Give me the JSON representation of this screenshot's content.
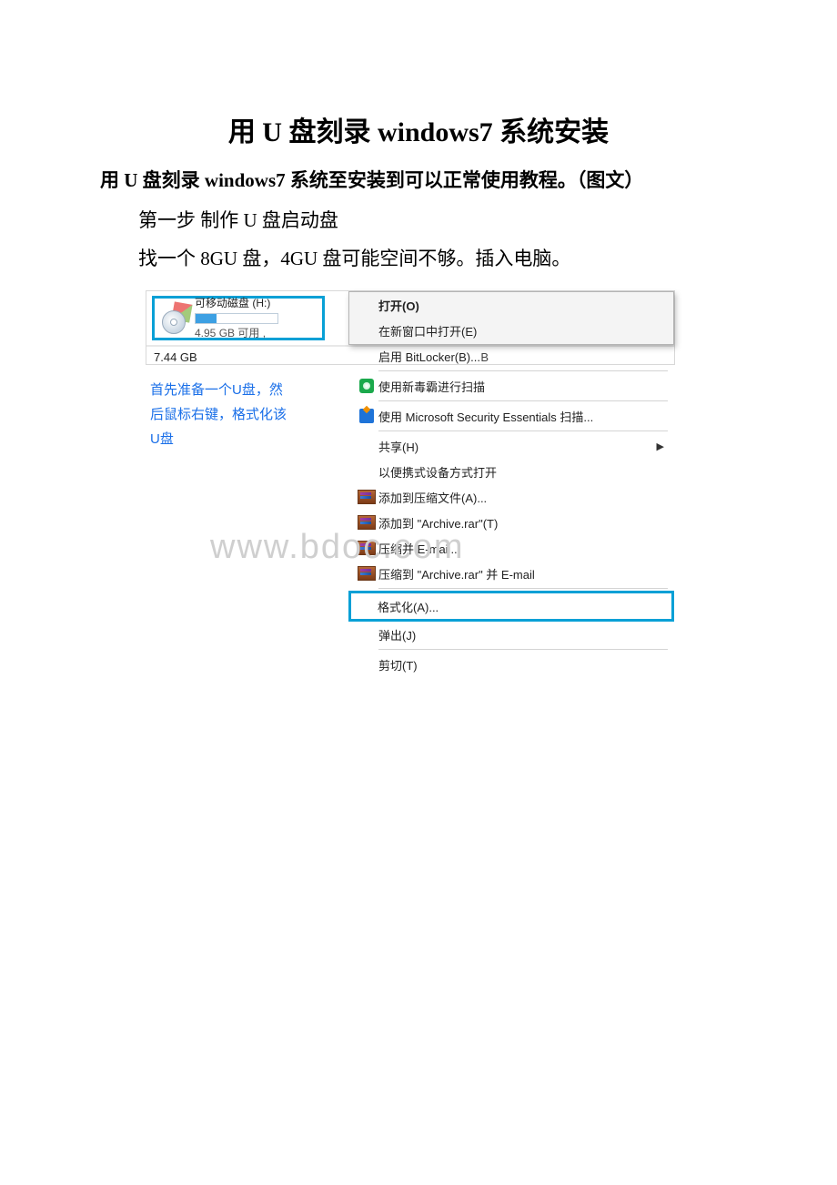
{
  "doc": {
    "title": "用 U 盘刻录 windows7 系统安装",
    "subtitle": "用 U 盘刻录 windows7 系统至安装到可以正常使用教程。（图文）",
    "step1": "第一步  制作 U 盘启动盘",
    "step2": "找一个 8GU 盘，4GU 盘可能空间不够。插入电脑。",
    "caption": "首先准备一个U盘，然后鼠标右键，格式化该U盘"
  },
  "screenshot": {
    "drive": {
      "name": "可移动磁盘 (H:)",
      "free": "4.95 GB 可用 ,"
    },
    "watermark": "www.bdoc.com",
    "menu": {
      "open": "打开(O)",
      "open_new": "在新窗口中打开(E)",
      "bitlocker": "启用 BitLocker(B)...",
      "scan1": "使用新毒霸进行扫描",
      "scan2": "使用 Microsoft Security Essentials 扫描...",
      "share": "共享(H)",
      "portable": "以便携式设备方式打开",
      "add_archive": "添加到压缩文件(A)...",
      "add_archive_rar": "添加到 \"Archive.rar\"(T)",
      "zip_email": "压缩并 E-mail...",
      "zip_rar_email": "压缩到 \"Archive.rar\" 并 E-mail",
      "format": "格式化(A)...",
      "eject": "弹出(J)",
      "cut": "剪切(T)"
    },
    "footer": {
      "size": "7.44 GB",
      "r": "B"
    }
  }
}
